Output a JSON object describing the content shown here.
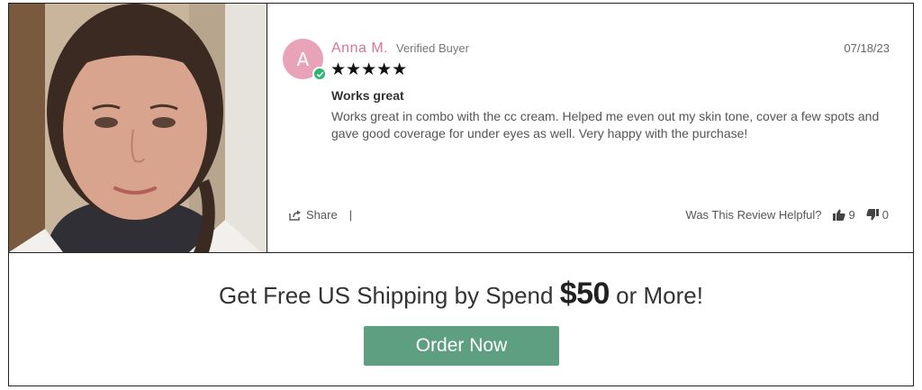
{
  "review": {
    "avatar_initial": "A",
    "reviewer_name": "Anna M.",
    "badge": "Verified Buyer",
    "date": "07/18/23",
    "rating": 5,
    "stars": "★★★★★",
    "title": "Works great",
    "body": "Works great in combo with the cc cream. Helped me even out my skin tone, cover a few spots and gave good coverage for under eyes as well. Very happy with the purchase!",
    "share_label": "Share",
    "separator": "|",
    "helpful_label": "Was This Review Helpful?",
    "upvotes": "9",
    "downvotes": "0"
  },
  "promo": {
    "text_before": "Get Free US Shipping by Spend ",
    "amount": "$50",
    "text_after": " or More!",
    "button_label": "Order Now"
  },
  "colors": {
    "name": "#d8749a",
    "avatar": "#e9a3b8",
    "verified_check": "#2bb673",
    "button": "#5e9f82"
  }
}
